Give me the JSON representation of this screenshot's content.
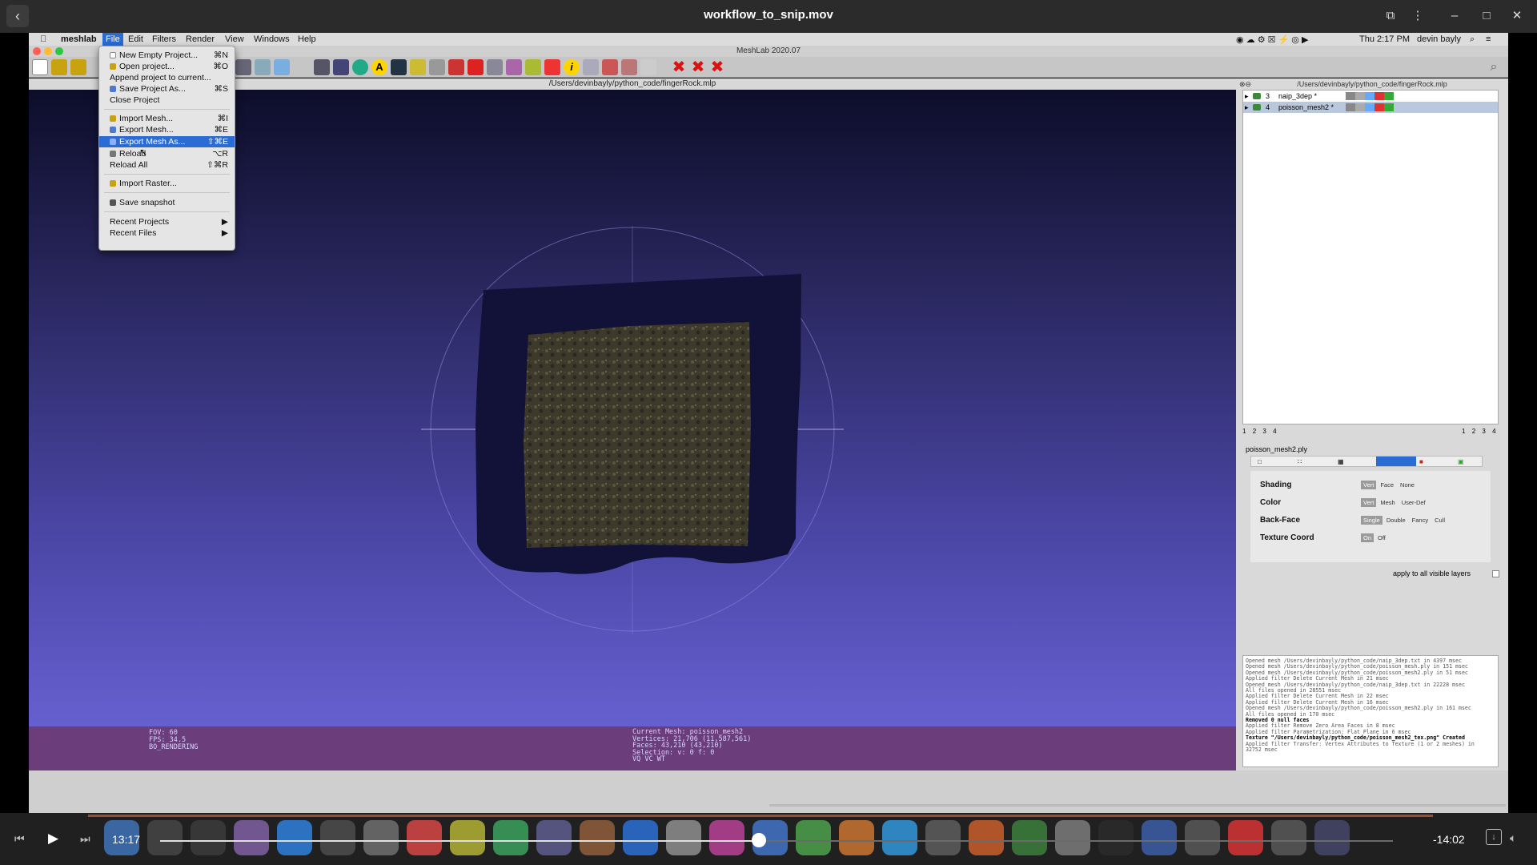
{
  "player": {
    "title": "workflow_to_snip.mov",
    "current_time": "13:17",
    "remaining_time": "-14:02",
    "progress": 0.486
  },
  "mac_menubar": {
    "apple": "",
    "items": [
      "meshlab",
      "File",
      "Edit",
      "Filters",
      "Render",
      "View",
      "Windows",
      "Help"
    ],
    "status": {
      "datetime": "Thu 2:17 PM",
      "user": "devin bayly"
    }
  },
  "app": {
    "title": "MeshLab 2020.07",
    "viewport_title": "/Users/devinbayly/python_code/fingerRock.mlp",
    "panel_title": "/Users/devinbayly/python_code/fingerRock.mlp"
  },
  "file_menu": {
    "items": [
      {
        "label": "New Empty Project...",
        "shortcut": "⌘N",
        "icon": "new-doc-icon",
        "icon_color": "#ffffff"
      },
      {
        "label": "Open project...",
        "shortcut": "⌘O",
        "icon": "folder-icon",
        "icon_color": "#c9a20f"
      },
      {
        "label": "Append project to current...",
        "shortcut": "",
        "icon": "",
        "icon_color": ""
      },
      {
        "label": "Save Project As...",
        "shortcut": "⌘S",
        "icon": "save-icon",
        "icon_color": "#4b7ad0"
      },
      {
        "label": "Close Project",
        "shortcut": "",
        "icon": "",
        "icon_color": ""
      },
      {
        "label": "Import Mesh...",
        "shortcut": "⌘I",
        "icon": "folder-icon",
        "icon_color": "#c9a20f"
      },
      {
        "label": "Export Mesh...",
        "shortcut": "⌘E",
        "icon": "save-icon",
        "icon_color": "#4b7ad0"
      },
      {
        "label": "Export Mesh As...",
        "shortcut": "⇧⌘E",
        "icon": "save-icon",
        "icon_color": "#4b7ad0",
        "highlighted": true
      },
      {
        "label": "Reload",
        "shortcut": "⌥R",
        "icon": "reload-icon",
        "icon_color": "#777777"
      },
      {
        "label": "Reload All",
        "shortcut": "⇧⌘R",
        "icon": "",
        "icon_color": ""
      },
      {
        "label": "Import Raster...",
        "shortcut": "",
        "icon": "folder-icon",
        "icon_color": "#c9a20f"
      },
      {
        "label": "Save snapshot",
        "shortcut": "",
        "icon": "camera-icon",
        "icon_color": "#555555"
      },
      {
        "label": "Recent Projects",
        "shortcut": "▶",
        "icon": "",
        "icon_color": ""
      },
      {
        "label": "Recent Files",
        "shortcut": "▶",
        "icon": "",
        "icon_color": ""
      }
    ]
  },
  "layers": [
    {
      "num": "3",
      "name": "naip_3dep *"
    },
    {
      "num": "4",
      "name": "poisson_mesh2 *",
      "selected": true
    }
  ],
  "layer_pages_left": [
    "1",
    "2",
    "3",
    "4"
  ],
  "layer_pages_right": [
    "1",
    "2",
    "3",
    "4"
  ],
  "render_panel": {
    "mesh_name": "poisson_mesh2.ply",
    "rows": [
      {
        "label": "Shading",
        "options": [
          "Vert",
          "Face",
          "None"
        ],
        "active": 0
      },
      {
        "label": "Color",
        "options": [
          "Vert",
          "Mesh",
          "User-Def"
        ],
        "active": 0
      },
      {
        "label": "Back-Face",
        "options": [
          "Single",
          "Double",
          "Fancy",
          "Cull"
        ],
        "active": 0
      },
      {
        "label": "Texture Coord",
        "options": [
          "On",
          "Off"
        ],
        "active": 0
      }
    ],
    "apply_all": "apply to all visible layers"
  },
  "log": [
    "Opened mesh /Users/devinbayly/python_code/naip_3dep.txt in 4397 msec",
    "Opened mesh /Users/devinbayly/python_code/poisson_mesh.ply in 151 msec",
    "Opened mesh /Users/devinbayly/python_code/poisson_mesh2.ply in 51 msec",
    "Applied filter Delete Current Mesh in 21 msec",
    "Opened mesh /Users/devinbayly/python_code/naip_3dep.txt in 22228 msec",
    "All files opened in 28551 msec",
    "Applied filter Delete Current Mesh in 22 msec",
    "Applied filter Delete Current Mesh in 16 msec",
    "Opened mesh /Users/devinbayly/python_code/poisson_mesh2.ply in 161 msec",
    "All files opened in 170 msec",
    "Removed 0 null faces",
    "Applied filter Remove Zero Area Faces in 8 msec",
    "Applied filter Parametrization: Flat Plane in 6 msec",
    "Texture \"/Users/devinbayly/python_code/poisson_mesh2_tex.png\" Created",
    "Applied filter Transfer: Vertex Attributes to Texture (1 or 2 meshes) in",
    "32752 msec"
  ],
  "viewport_info": {
    "left": [
      "FOV: 60",
      "FPS:    34.5",
      "BO_RENDERING"
    ],
    "right": [
      "Current Mesh: poisson_mesh2",
      "Vertices: 21,706    (11,587,561)",
      "Faces: 43,210    (43,210)",
      "Selection: v: 0 f: 0",
      "VQ VC WT"
    ]
  }
}
